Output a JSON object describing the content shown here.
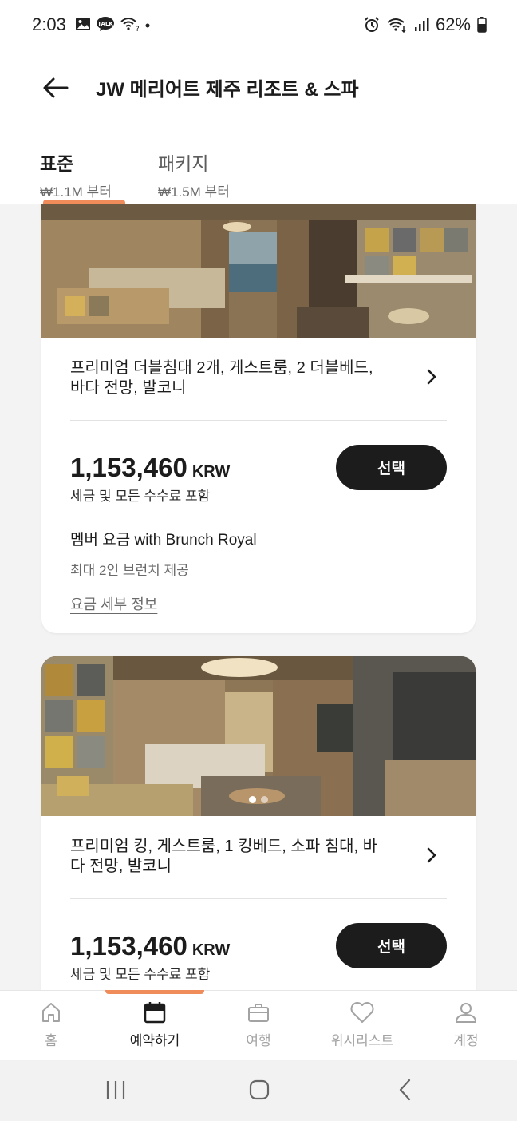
{
  "status_bar": {
    "time": "2:03",
    "battery": "62%"
  },
  "header": {
    "title": "JW 메리어트 제주 리조트 & 스파"
  },
  "tabs": [
    {
      "label": "표준",
      "sub": "₩1.1M 부터",
      "active": true
    },
    {
      "label": "패키지",
      "sub": "₩1.5M 부터",
      "active": false
    }
  ],
  "rooms": [
    {
      "name": "프리미엄 더블침대 2개, 게스트룸, 2 더블베드, 바다 전망, 발코니",
      "price": "1,153,460",
      "currency": "KRW",
      "tax_note": "세금 및 모든 수수료 포함",
      "select_label": "선택",
      "rate_name": "멤버 요금 with Brunch Royal",
      "rate_desc": "최대 2인 브런치 제공",
      "rate_link": "요금 세부 정보"
    },
    {
      "name": "프리미엄 킹, 게스트룸, 1 킹베드, 소파 침대, 바다 전망, 발코니",
      "price": "1,153,460",
      "currency": "KRW",
      "tax_note": "세금 및 모든 수수료 포함",
      "select_label": "선택",
      "image_pages": 2,
      "image_current_page": 1
    }
  ],
  "bottom_nav": [
    {
      "label": "홈",
      "icon": "home-icon"
    },
    {
      "label": "예약하기",
      "icon": "calendar-icon",
      "active": true
    },
    {
      "label": "여행",
      "icon": "suitcase-icon"
    },
    {
      "label": "위시리스트",
      "icon": "heart-icon"
    },
    {
      "label": "계정",
      "icon": "person-icon"
    }
  ],
  "colors": {
    "accent": "#f08b5a",
    "button_bg": "#1c1c1c",
    "background": "#f3f3f3"
  }
}
